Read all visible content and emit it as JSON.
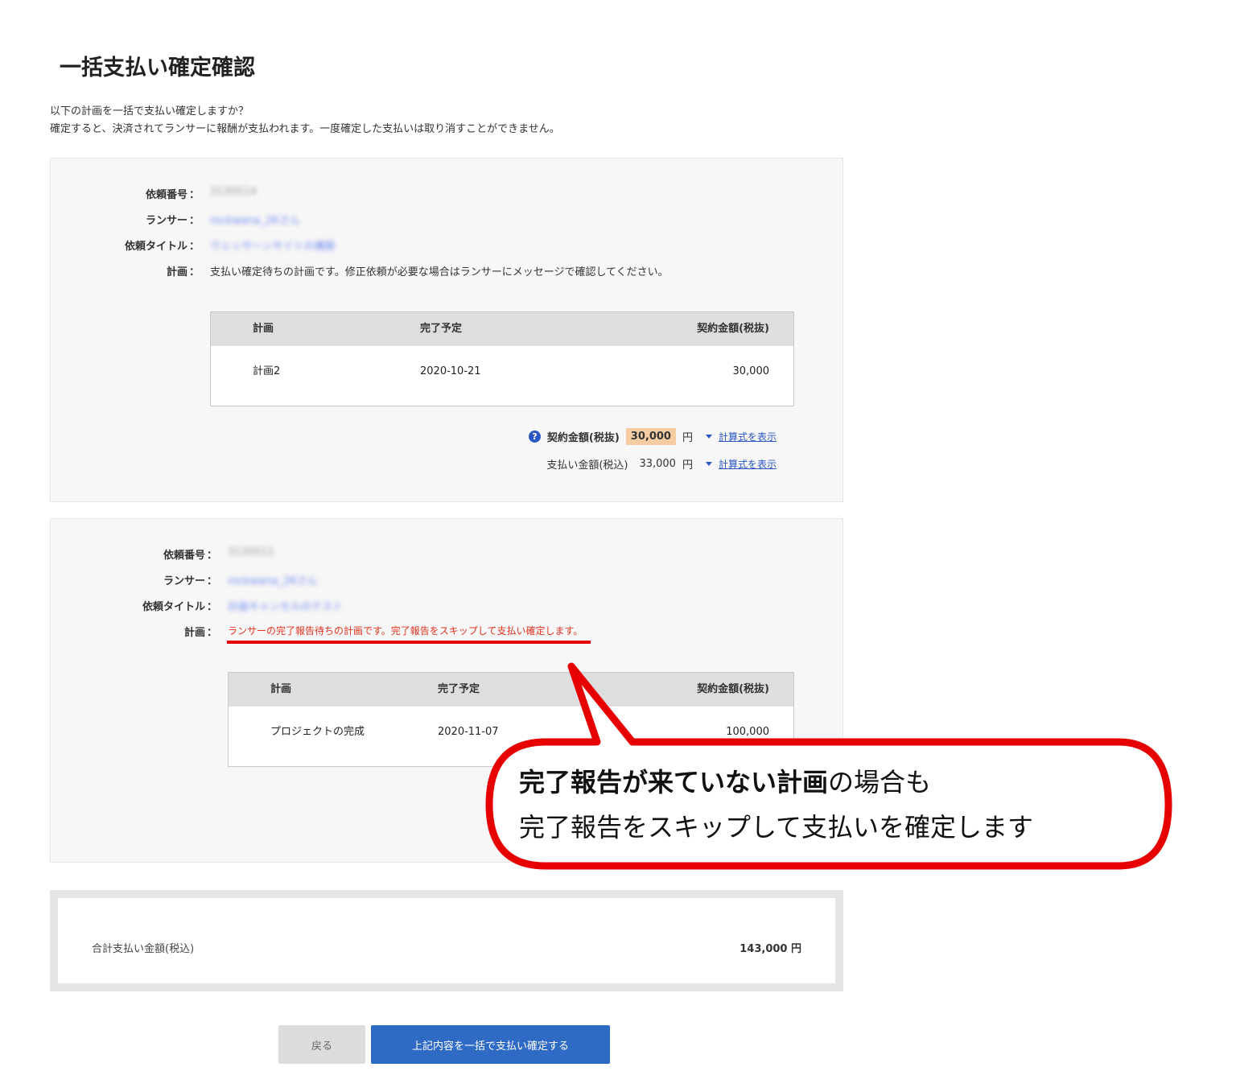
{
  "page": {
    "title": "一括支払い確定確認",
    "intro_line1": "以下の計画を一括で支払い確定しますか？",
    "intro_line2": "確定すると、決済されてランサーに報酬が支払われます。一度確定した支払いは取り消すことができません。"
  },
  "labels": {
    "request_no": "依頼番号",
    "lancer": "ランサー",
    "request_title": "依頼タイトル",
    "plan": "計画",
    "colon": "："
  },
  "table_headers": {
    "plan": "計画",
    "due": "完了予定",
    "amount": "契約金額(税抜)"
  },
  "cards": [
    {
      "request_no": "3130514",
      "lancer": "rockwana_2Kさん",
      "request_title": "ウェッサーンサイトの構築",
      "plan_note": "支払い確定待ちの計画です。修正依頼が必要な場合はランサーにメッセージで確認してください。",
      "row": {
        "plan": "計画2",
        "due": "2020-10-21",
        "amount": "30,000"
      },
      "summary": {
        "contract_label": "契約金額(税抜)",
        "contract_amount": "30,000",
        "payment_label": "支払い金額(税込)",
        "payment_amount": "33,000",
        "yen": "円",
        "calc_link": "計算式を表示"
      }
    },
    {
      "request_no": "3130511",
      "lancer": "rockwana_2Kさん",
      "request_title": "計画キャンセルのテスト",
      "plan_note": "ランサーの完了報告待ちの計画です。完了報告をスキップして支払い確定します。",
      "row": {
        "plan": "プロジェクトの完成",
        "due": "2020-11-07",
        "amount": "100,000"
      }
    }
  ],
  "callout": {
    "line1_strong": "完了報告が来ていない計画",
    "line1_rest": "の場合も",
    "line2": "完了報告をスキップして支払いを確定します"
  },
  "total": {
    "label": "合計支払い金額(税込)",
    "value": "143,000 円"
  },
  "buttons": {
    "back": "戻る",
    "confirm": "上記内容を一括で支払い確定する"
  },
  "icons": {
    "help": "help-circle-icon",
    "dropdown": "triangle-down-icon"
  },
  "colors": {
    "primary": "#2f6ac4",
    "warning": "#e2321f",
    "highlight": "#f6cda2",
    "callout_border": "#e60000"
  }
}
